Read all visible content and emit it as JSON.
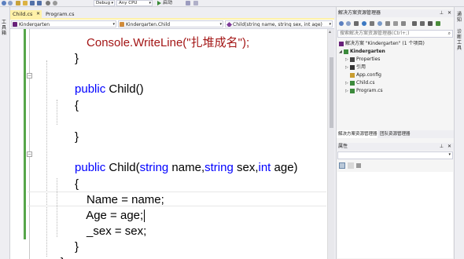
{
  "toolbar": {
    "config": "Debug",
    "platform": "Any CPU",
    "start_label": "启动"
  },
  "left_strip": {
    "label": "工具箱"
  },
  "tabs": [
    {
      "label": "Child.cs",
      "active": true
    },
    {
      "label": "Program.cs",
      "active": false
    }
  ],
  "nav": {
    "project": "Kindergarten",
    "type": "Kindergarten.Child",
    "member": "Child(string name, string sex, int age)"
  },
  "code": {
    "line0": "Console.WriteLine(\"扎堆成名\");",
    "brace_close_1": "}",
    "ctor1_public": "public",
    "ctor1_rest": " Child()",
    "brace_open_2": "{",
    "brace_close_2": "}",
    "ctor2_public": "public",
    "ctor2_name": " Child(",
    "ctor2_string1": "string",
    "ctor2_p1": " name,",
    "ctor2_string2": "string",
    "ctor2_p2": " sex,",
    "ctor2_int": "int",
    "ctor2_p3": " age)",
    "brace_open_3": "{",
    "stmt1": "Name = name;",
    "stmt2": "Age = age;",
    "stmt3": "_sex = sex;",
    "brace_close_3": "}",
    "brace_close_4": "}"
  },
  "solution_explorer": {
    "title": "解决方案资源管理器",
    "search_placeholder": "搜索解决方案资源管理器(Ctrl+;)",
    "items": [
      {
        "label": "解决方案 \"Kindergarten\" (1 个项目)",
        "icon": "solution-icon"
      },
      {
        "label": "Kindergarten",
        "icon": "csharp-project-icon"
      },
      {
        "label": "Properties",
        "icon": "wrench-icon"
      },
      {
        "label": "引用",
        "icon": "references-icon"
      },
      {
        "label": "App.config",
        "icon": "config-file-icon"
      },
      {
        "label": "Child.cs",
        "icon": "csharp-file-icon"
      },
      {
        "label": "Program.cs",
        "icon": "csharp-file-icon"
      }
    ]
  },
  "bottom_tabs": [
    {
      "label": "解决方案资源管理器",
      "active": true
    },
    {
      "label": "团队资源管理器",
      "active": false
    }
  ],
  "properties": {
    "title": "属性"
  },
  "far_right": {
    "label1": "通知",
    "label2": "诊断工具"
  },
  "colors": {
    "keyword": "#0000ff",
    "change_bar": "#57a64a",
    "active_tab": "#fff1a8",
    "selection": "#cce8ff"
  }
}
